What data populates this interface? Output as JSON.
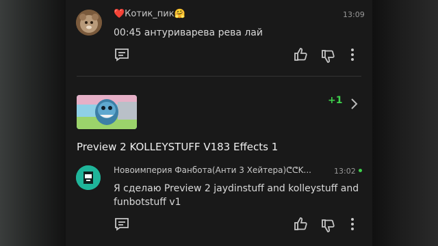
{
  "comments": [
    {
      "author": "❤️Котик_пик🤗",
      "time": "13:09",
      "text": "00:45 антуриварева рева лай"
    },
    {
      "author": "Новоимперия Фанбота(Анти 3 Хейтера)ᕦᕦK...",
      "time": "13:02",
      "text_line1": "Я сделаю Preview 2 jaydinstuff and kolleystuff and",
      "text_line2": "funbotstuff v1"
    }
  ],
  "video": {
    "title": "Preview 2 KOLLEYSTUFF V183 Effects 1",
    "reply_count": "+1"
  },
  "colors": {
    "accent_green": "#3ed14c",
    "panel": "#191919"
  },
  "icons": [
    "reply-icon",
    "like-icon",
    "dislike-icon",
    "more-icon",
    "chevron-right-icon"
  ]
}
